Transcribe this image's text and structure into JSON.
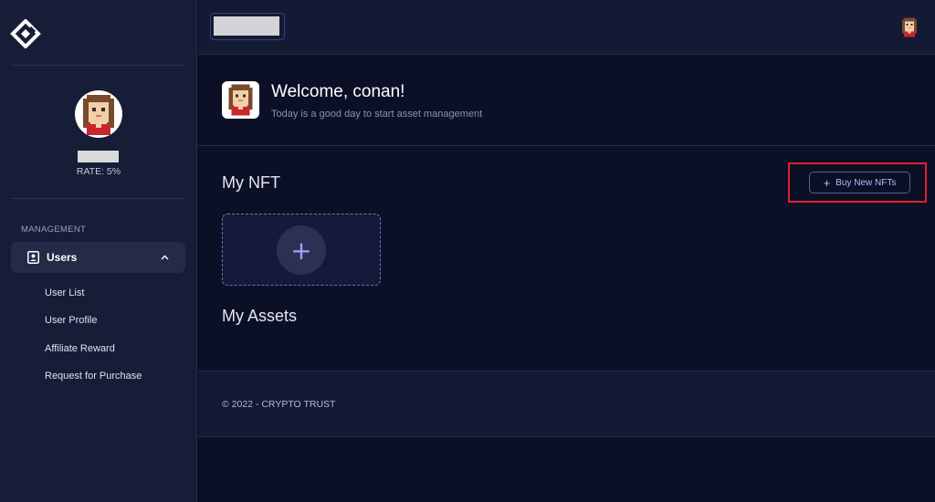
{
  "sidebar": {
    "logo_icon": "diamond-logo-icon",
    "profile": {
      "avatar_icon": "pixel-avatar-icon",
      "rate_text": "RATE: 5%"
    },
    "section_label": "MANAGEMENT",
    "group": {
      "icon": "user-badge-icon",
      "label": "Users",
      "chevron_icon": "chevron-up-icon",
      "expanded": true
    },
    "sub_items": [
      {
        "label": "User List"
      },
      {
        "label": "User Profile"
      },
      {
        "label": "Affiliate Reward"
      },
      {
        "label": "Request for Purchase"
      }
    ]
  },
  "header": {
    "avatar_icon": "pixel-avatar-icon"
  },
  "welcome": {
    "title": "Welcome, conan!",
    "subtitle": "Today is a good day to start asset management"
  },
  "nft_section": {
    "title": "My NFT",
    "buy_button": {
      "icon": "plus-icon",
      "label": "Buy New NFTs"
    },
    "add_card_icon": "plus-icon"
  },
  "assets_section": {
    "title": "My Assets"
  },
  "footer": {
    "text": "© 2022 - CRYPTO TRUST"
  },
  "colors": {
    "background": "#0b1027",
    "sidebar": "#171c37",
    "accent": "#9da4ff",
    "highlight": "#e2202c"
  }
}
